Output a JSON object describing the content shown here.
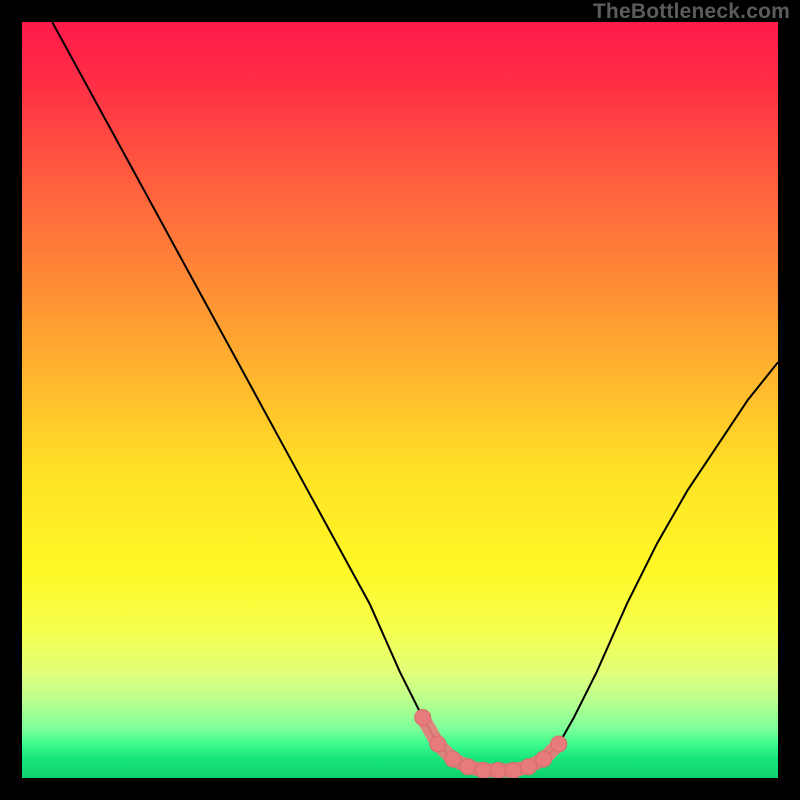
{
  "attribution": "TheBottleneck.com",
  "colors": {
    "bg_black": "#000000",
    "curve": "#000000",
    "marker_fill": "#e77b7b",
    "marker_stroke": "#d86a6a",
    "gradient_stops": [
      {
        "offset": 0.0,
        "color": "#ff1a4a"
      },
      {
        "offset": 0.08,
        "color": "#ff2e45"
      },
      {
        "offset": 0.2,
        "color": "#ff5a3f"
      },
      {
        "offset": 0.34,
        "color": "#ff8a36"
      },
      {
        "offset": 0.48,
        "color": "#ffb92d"
      },
      {
        "offset": 0.6,
        "color": "#ffe326"
      },
      {
        "offset": 0.72,
        "color": "#fff725"
      },
      {
        "offset": 0.8,
        "color": "#f6ff4a"
      },
      {
        "offset": 0.86,
        "color": "#e2ff7a"
      },
      {
        "offset": 0.9,
        "color": "#b7ff8f"
      },
      {
        "offset": 0.935,
        "color": "#7dff9a"
      },
      {
        "offset": 0.955,
        "color": "#3efb8e"
      },
      {
        "offset": 0.975,
        "color": "#16e57a"
      },
      {
        "offset": 1.0,
        "color": "#0fd06e"
      }
    ]
  },
  "chart_data": {
    "type": "line",
    "title": "",
    "xlabel": "",
    "ylabel": "",
    "xlim": [
      0,
      100
    ],
    "ylim": [
      0,
      100
    ],
    "series": [
      {
        "name": "bottleneck-curve",
        "x": [
          4,
          10,
          16,
          22,
          28,
          34,
          40,
          46,
          50,
          53,
          55,
          57,
          59,
          61,
          63,
          65,
          67,
          69,
          71,
          73,
          76,
          80,
          84,
          88,
          92,
          96,
          100
        ],
        "y": [
          100,
          89,
          78,
          67,
          56,
          45,
          34,
          23,
          14,
          8,
          4.5,
          2.5,
          1.5,
          1,
          1,
          1,
          1.5,
          2.5,
          4.5,
          8,
          14,
          23,
          31,
          38,
          44,
          50,
          55
        ]
      }
    ],
    "markers": {
      "name": "highlighted-range",
      "x": [
        53,
        55,
        57,
        59,
        61,
        63,
        65,
        67,
        69,
        71
      ],
      "y": [
        8,
        4.5,
        2.5,
        1.5,
        1,
        1,
        1,
        1.5,
        2.5,
        4.5
      ]
    }
  }
}
